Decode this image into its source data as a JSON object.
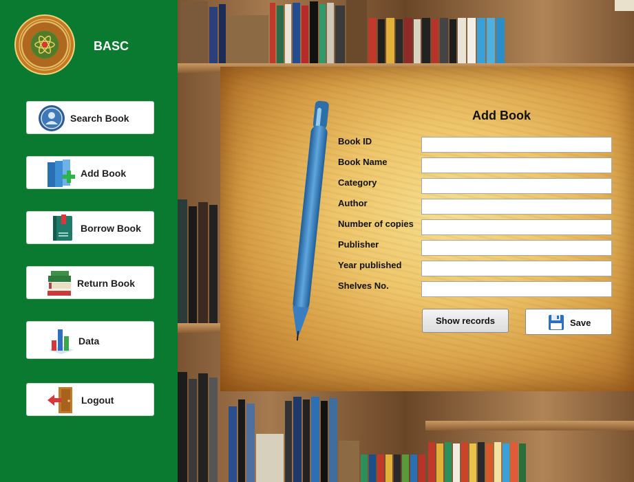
{
  "app": {
    "name": "BASC",
    "logo": "college-seal-logo"
  },
  "sidebar": {
    "items": [
      {
        "label": "Search Book",
        "icon": "user-circle-icon"
      },
      {
        "label": "Add Book",
        "icon": "books-add-icon"
      },
      {
        "label": "Borrow Book",
        "icon": "book-bookmark-icon"
      },
      {
        "label": "Return Book",
        "icon": "book-stack-icon"
      },
      {
        "label": "Data",
        "icon": "bar-chart-icon"
      },
      {
        "label": "Logout",
        "icon": "exit-door-icon"
      }
    ]
  },
  "form": {
    "title": "Add Book",
    "fields": [
      {
        "label": "Book ID",
        "value": ""
      },
      {
        "label": "Book Name",
        "value": ""
      },
      {
        "label": "Category",
        "value": ""
      },
      {
        "label": "Author",
        "value": ""
      },
      {
        "label": "Number of copies",
        "value": ""
      },
      {
        "label": "Publisher",
        "value": ""
      },
      {
        "label": "Year published",
        "value": ""
      },
      {
        "label": "Shelves No.",
        "value": ""
      }
    ],
    "show_records_label": "Show records",
    "save_label": "Save"
  },
  "colors": {
    "sidebar": "#0b7a31",
    "panel": "#eec56a",
    "button_bg": "#ffffff"
  }
}
